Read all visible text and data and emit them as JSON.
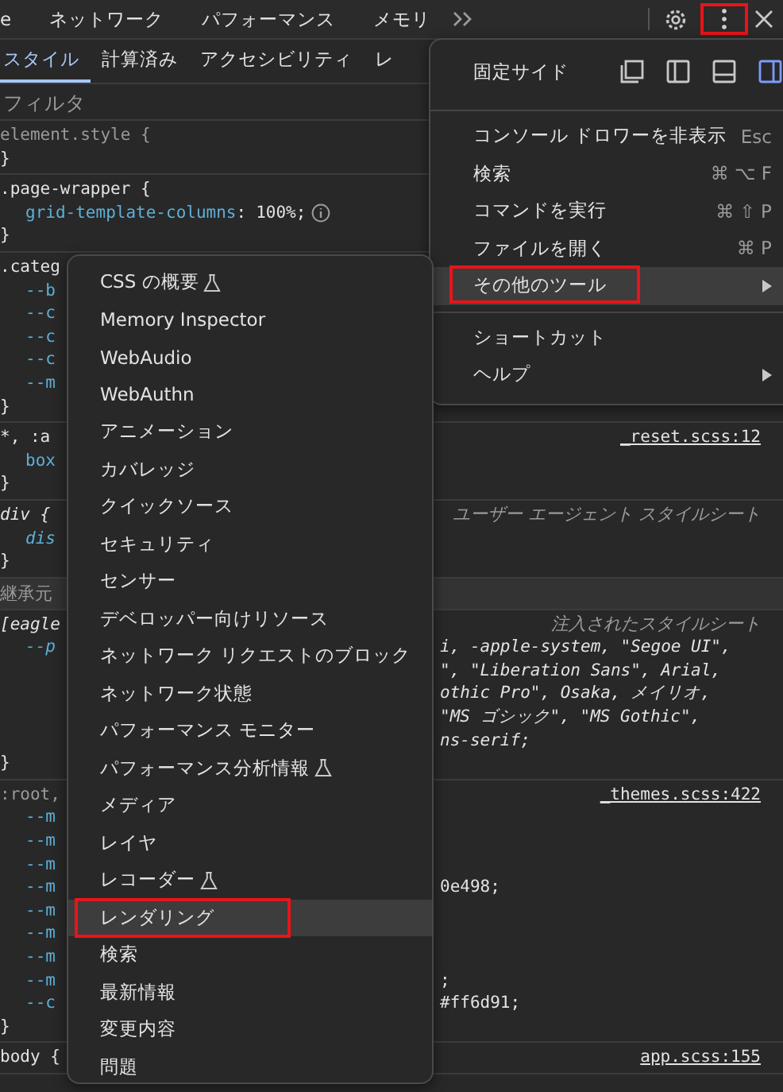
{
  "toolbar": {
    "tabs": [
      {
        "label": "e",
        "selected": false
      },
      {
        "label": "ネットワーク",
        "selected": false
      },
      {
        "label": "パフォーマンス",
        "selected": false
      },
      {
        "label": "メモリ",
        "selected": false
      }
    ],
    "menu_button": {
      "annotated": true
    }
  },
  "subtabs": [
    {
      "label": "スタイル",
      "selected": true
    },
    {
      "label": "計算済み",
      "selected": false
    },
    {
      "label": "アクセシビリティ",
      "selected": false
    },
    {
      "label": "レ",
      "selected": false
    }
  ],
  "filter": {
    "placeholder": "フィルタ"
  },
  "sections": [
    {
      "kind": "rule",
      "italic": false,
      "rows": [
        {
          "kind": "selector",
          "text": "element.style {",
          "muted": true
        },
        {
          "kind": "brace",
          "text": "}"
        }
      ]
    },
    {
      "kind": "rule",
      "italic": false,
      "rows": [
        {
          "kind": "selector",
          "text": ".page-wrapper {",
          "muted": false
        },
        {
          "kind": "property",
          "name": "grid-template-columns",
          "separator": ":",
          "value": "100%;",
          "info": true
        },
        {
          "kind": "brace",
          "text": "}"
        }
      ]
    },
    {
      "kind": "rule",
      "italic": false,
      "rows": [
        {
          "kind": "selector",
          "text": ".categ",
          "muted": false
        },
        {
          "kind": "property",
          "name": "--b",
          "info": false
        },
        {
          "kind": "property",
          "name": "--c",
          "info": false
        },
        {
          "kind": "property",
          "name": "--c",
          "info": false
        },
        {
          "kind": "property",
          "name": "--c",
          "info": false
        },
        {
          "kind": "property",
          "name": "--m",
          "info": false
        },
        {
          "kind": "brace",
          "text": "}"
        }
      ]
    },
    {
      "kind": "rule",
      "italic": false,
      "rows": [
        {
          "kind": "selector",
          "text": "*, :a",
          "muted": false,
          "aside": {
            "kind": "link",
            "text": "_reset.scss:12"
          }
        },
        {
          "kind": "property",
          "name": "box",
          "info": false
        },
        {
          "kind": "brace",
          "text": "}"
        }
      ]
    },
    {
      "kind": "rule",
      "italic": true,
      "rows": [
        {
          "kind": "selector",
          "text": "div {",
          "muted": false,
          "aside": {
            "kind": "origin",
            "text": "ユーザー エージェント スタイルシート"
          }
        },
        {
          "kind": "property",
          "name": "dis",
          "info": false
        },
        {
          "kind": "brace",
          "text": "}"
        }
      ]
    },
    {
      "kind": "header",
      "text": "継承元"
    },
    {
      "kind": "rule",
      "italic": true,
      "rows": [
        {
          "kind": "selector",
          "text": "[eagle",
          "muted": false,
          "aside": {
            "kind": "origin",
            "text": "注入されたスタイルシート"
          }
        },
        {
          "kind": "property",
          "name": "--p",
          "info": false,
          "aside": {
            "kind": "code",
            "text": "i, -apple-system, \"Segoe UI\","
          }
        },
        {
          "kind": "continuation",
          "aside": {
            "kind": "code",
            "text": "\", \"Liberation Sans\", Arial,"
          }
        },
        {
          "kind": "continuation",
          "aside": {
            "kind": "code",
            "text": "othic Pro\", Osaka, メイリオ,"
          }
        },
        {
          "kind": "continuation",
          "aside": {
            "kind": "code",
            "text": "\"MS ゴシック\", \"MS Gothic\","
          }
        },
        {
          "kind": "continuation",
          "aside": {
            "kind": "code",
            "text": "ns-serif;"
          }
        },
        {
          "kind": "brace",
          "text": "}"
        }
      ]
    },
    {
      "kind": "rule",
      "italic": false,
      "rows": [
        {
          "kind": "selector",
          "text": ":root,",
          "muted": true,
          "aside": {
            "kind": "link",
            "text": "_themes.scss:422"
          }
        },
        {
          "kind": "property",
          "name": "--m",
          "info": false
        },
        {
          "kind": "property",
          "name": "--m",
          "info": false
        },
        {
          "kind": "property",
          "name": "--m",
          "info": false
        },
        {
          "kind": "property",
          "name": "--m",
          "info": false,
          "aside": {
            "kind": "code",
            "text": "0e498;"
          }
        },
        {
          "kind": "property",
          "name": "--m",
          "info": false
        },
        {
          "kind": "property",
          "name": "--m",
          "info": false
        },
        {
          "kind": "property",
          "name": "--m",
          "info": false
        },
        {
          "kind": "property",
          "name": "--m",
          "info": false,
          "aside": {
            "kind": "code",
            "text": ";"
          }
        },
        {
          "kind": "property",
          "name": "--c",
          "info": false,
          "aside": {
            "kind": "code",
            "text": "#ff6d91;"
          }
        },
        {
          "kind": "brace",
          "text": "}"
        }
      ]
    },
    {
      "kind": "rule",
      "italic": false,
      "rows": [
        {
          "kind": "selector",
          "text": "body {",
          "muted": false,
          "aside": {
            "kind": "link",
            "text": "app.scss:155"
          }
        }
      ]
    }
  ],
  "main_menu": {
    "dock": {
      "label": "固定サイド",
      "options": [
        {
          "kind": "undock",
          "selected": false
        },
        {
          "kind": "left",
          "selected": false
        },
        {
          "kind": "bottom",
          "selected": false
        },
        {
          "kind": "right",
          "selected": true
        }
      ]
    },
    "groups": [
      [
        {
          "label": "コンソール ドロワーを非表示",
          "shortcut": "Esc",
          "submenu": false,
          "hovered": false,
          "annotated": false
        },
        {
          "label": "検索",
          "shortcut": "⌘ ⌥ F",
          "submenu": false,
          "hovered": false,
          "annotated": false
        },
        {
          "label": "コマンドを実行",
          "shortcut": "⌘ ⇧ P",
          "submenu": false,
          "hovered": false,
          "annotated": false
        },
        {
          "label": "ファイルを開く",
          "shortcut": "⌘ P",
          "submenu": false,
          "hovered": false,
          "annotated": false
        },
        {
          "label": "その他のツール",
          "submenu": true,
          "hovered": true,
          "annotated": true
        }
      ],
      [
        {
          "label": "ショートカット",
          "submenu": false,
          "hovered": false,
          "annotated": false
        },
        {
          "label": "ヘルプ",
          "submenu": true,
          "hovered": false,
          "annotated": false
        }
      ]
    ]
  },
  "submenu": {
    "items": [
      {
        "label": "CSS の概要",
        "experimental": true,
        "hovered": false,
        "annotated": false
      },
      {
        "label": "Memory Inspector",
        "experimental": false,
        "hovered": false,
        "annotated": false
      },
      {
        "label": "WebAudio",
        "experimental": false,
        "hovered": false,
        "annotated": false
      },
      {
        "label": "WebAuthn",
        "experimental": false,
        "hovered": false,
        "annotated": false
      },
      {
        "label": "アニメーション",
        "experimental": false,
        "hovered": false,
        "annotated": false
      },
      {
        "label": "カバレッジ",
        "experimental": false,
        "hovered": false,
        "annotated": false
      },
      {
        "label": "クイックソース",
        "experimental": false,
        "hovered": false,
        "annotated": false
      },
      {
        "label": "セキュリティ",
        "experimental": false,
        "hovered": false,
        "annotated": false
      },
      {
        "label": "センサー",
        "experimental": false,
        "hovered": false,
        "annotated": false
      },
      {
        "label": "デベロッパー向けリソース",
        "experimental": false,
        "hovered": false,
        "annotated": false
      },
      {
        "label": "ネットワーク リクエストのブロック",
        "experimental": false,
        "hovered": false,
        "annotated": false
      },
      {
        "label": "ネットワーク状態",
        "experimental": false,
        "hovered": false,
        "annotated": false
      },
      {
        "label": "パフォーマンス モニター",
        "experimental": false,
        "hovered": false,
        "annotated": false
      },
      {
        "label": "パフォーマンス分析情報",
        "experimental": true,
        "hovered": false,
        "annotated": false
      },
      {
        "label": "メディア",
        "experimental": false,
        "hovered": false,
        "annotated": false
      },
      {
        "label": "レイヤ",
        "experimental": false,
        "hovered": false,
        "annotated": false
      },
      {
        "label": "レコーダー",
        "experimental": true,
        "hovered": false,
        "annotated": false
      },
      {
        "label": "レンダリング",
        "experimental": false,
        "hovered": true,
        "annotated": true
      },
      {
        "label": "検索",
        "experimental": false,
        "hovered": false,
        "annotated": false
      },
      {
        "label": "最新情報",
        "experimental": false,
        "hovered": false,
        "annotated": false
      },
      {
        "label": "変更内容",
        "experimental": false,
        "hovered": false,
        "annotated": false
      },
      {
        "label": "問題",
        "experimental": false,
        "hovered": false,
        "annotated": false
      }
    ]
  }
}
